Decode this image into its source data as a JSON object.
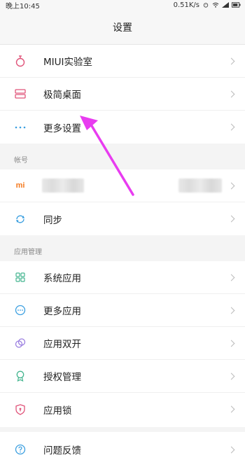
{
  "status_bar": {
    "time": "晚上10:45",
    "network_speed": "0.51K/s"
  },
  "header": {
    "title": "设置"
  },
  "group1": [
    {
      "label": "MIUI实验室",
      "icon": "flask-icon"
    },
    {
      "label": "极简桌面",
      "icon": "simple-desktop-icon"
    },
    {
      "label": "更多设置",
      "icon": "more-dots-icon"
    }
  ],
  "sections": {
    "account_header": "帐号",
    "app_mgmt_header": "应用管理"
  },
  "account": {
    "mi_logo": "mi",
    "sync_label": "同步"
  },
  "group3": [
    {
      "label": "系统应用",
      "icon": "grid-icon"
    },
    {
      "label": "更多应用",
      "icon": "more-circle-icon"
    },
    {
      "label": "应用双开",
      "icon": "dual-circle-icon"
    },
    {
      "label": "授权管理",
      "icon": "badge-icon"
    },
    {
      "label": "应用锁",
      "icon": "shield-lock-icon"
    }
  ],
  "group4": [
    {
      "label": "问题反馈",
      "icon": "help-icon"
    }
  ],
  "colors": {
    "accent_blue": "#3b9fe0",
    "accent_pink": "#e0547a",
    "accent_green": "#43b58f",
    "mi_orange": "#f47a20",
    "annotation_magenta": "#e83cf0"
  }
}
